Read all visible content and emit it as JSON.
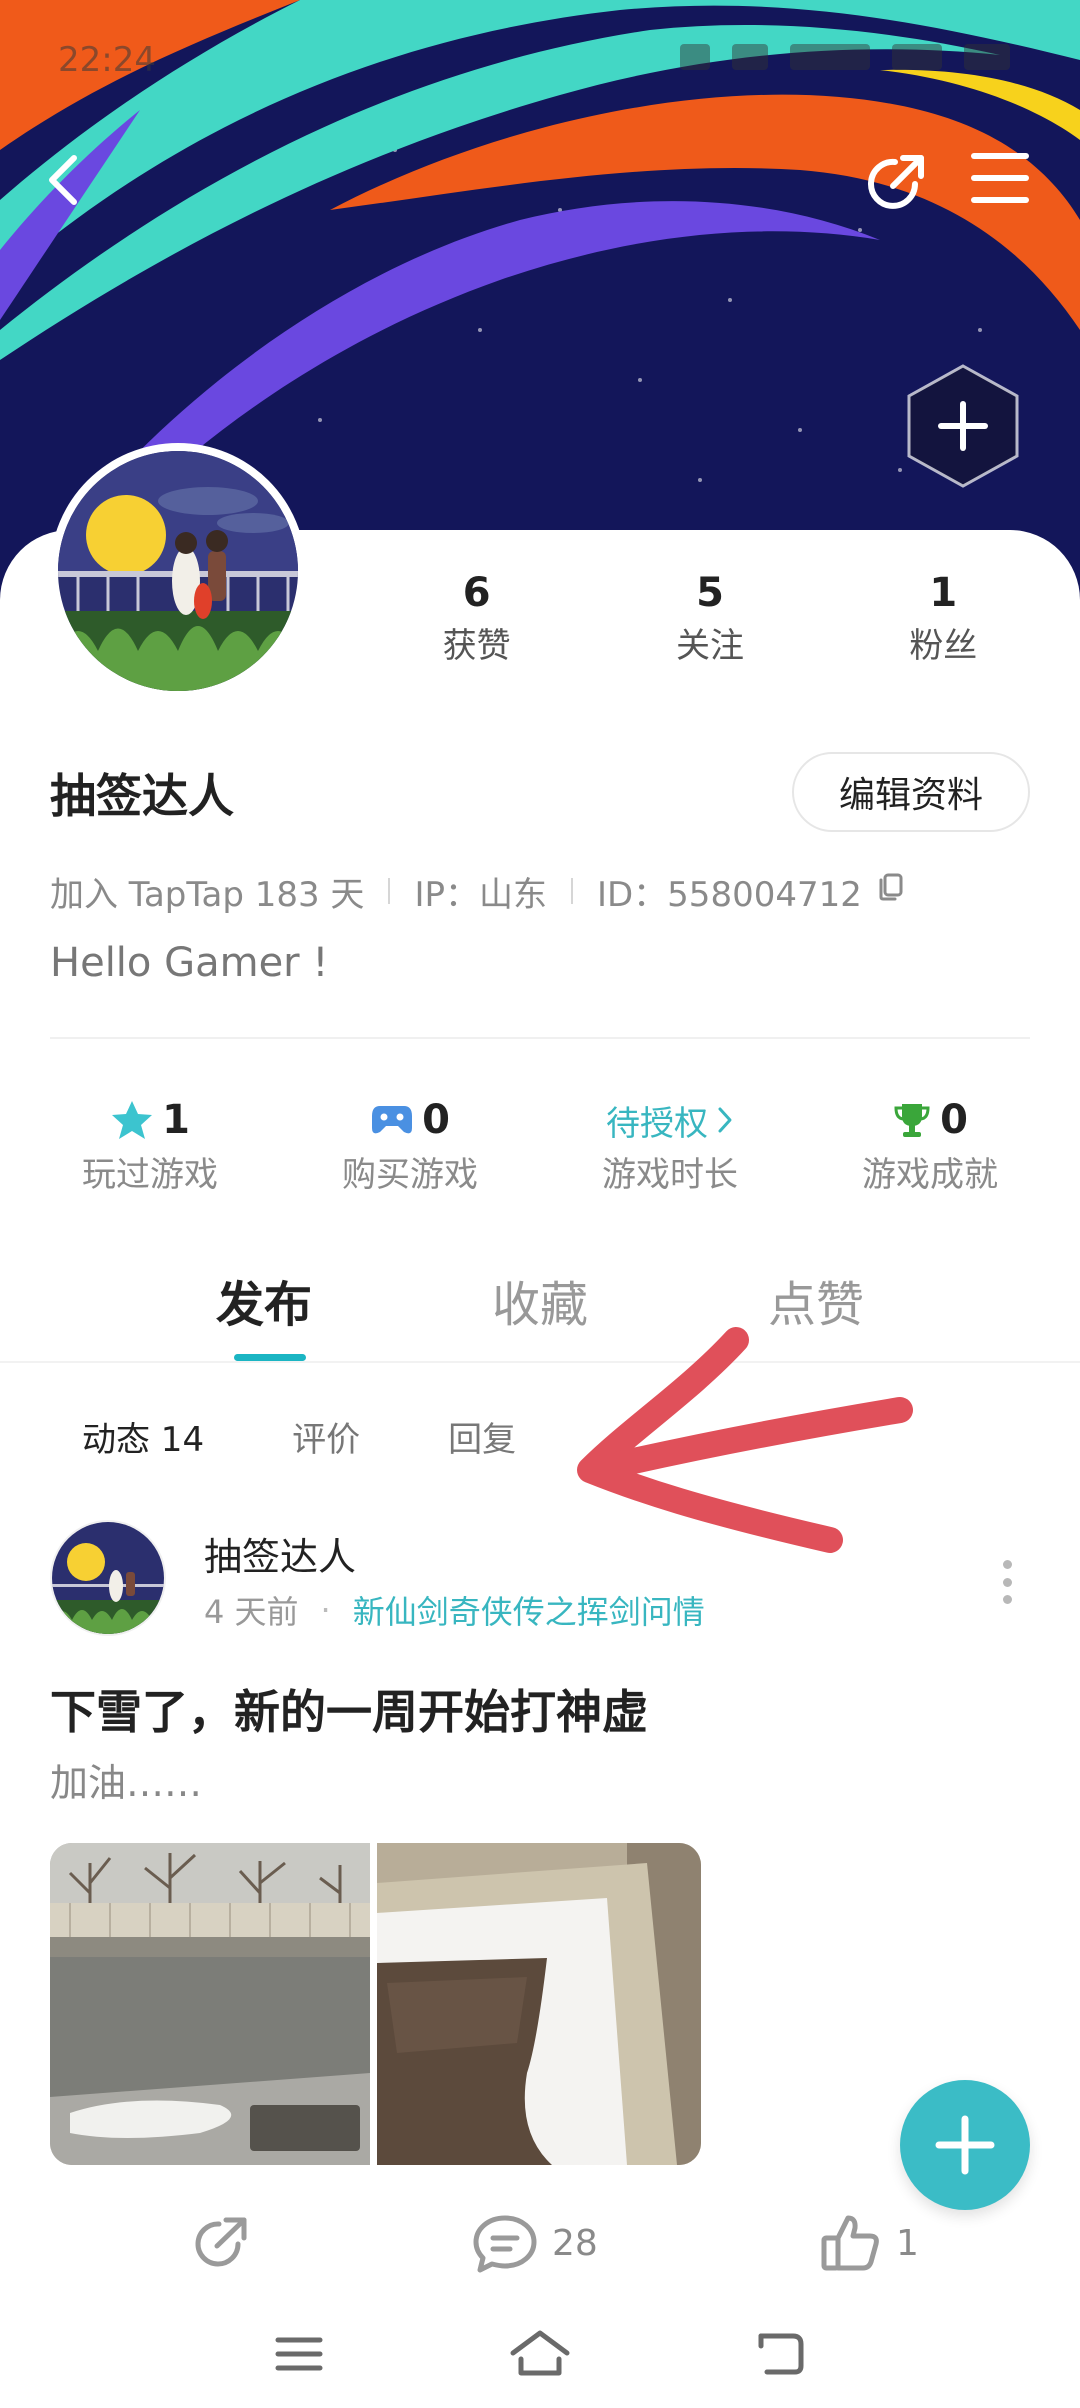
{
  "status_bar": {
    "time": "22:24"
  },
  "profile": {
    "stats": [
      {
        "value": "6",
        "label": "获赞"
      },
      {
        "value": "5",
        "label": "关注"
      },
      {
        "value": "1",
        "label": "粉丝"
      }
    ],
    "username": "抽签达人",
    "edit_label": "编辑资料",
    "joined": "加入 TapTap 183 天",
    "ip": "IP：山东",
    "id": "ID：558004712",
    "bio": "Hello Gamer !"
  },
  "game_stats": [
    {
      "value": "1",
      "label": "玩过游戏",
      "icon": "star-icon"
    },
    {
      "value": "0",
      "label": "购买游戏",
      "icon": "gamepad-icon"
    },
    {
      "value": "待授权",
      "label": "游戏时长",
      "icon": "chevron-right-icon"
    },
    {
      "value": "0",
      "label": "游戏成就",
      "icon": "trophy-icon"
    }
  ],
  "main_tabs": [
    "发布",
    "收藏",
    "点赞"
  ],
  "sub_tabs": [
    "动态 14",
    "评价",
    "回复"
  ],
  "post": {
    "author": "抽签达人",
    "time": "4 天前",
    "game": "新仙剑奇侠传之挥剑问情",
    "title": "下雪了，新的一周开始打神虚",
    "body": "加油……",
    "comments": "28",
    "likes": "1"
  },
  "colors": {
    "accent": "#38b6c0",
    "banner_navy": "#13165a",
    "annotation_red": "#e0505a"
  }
}
